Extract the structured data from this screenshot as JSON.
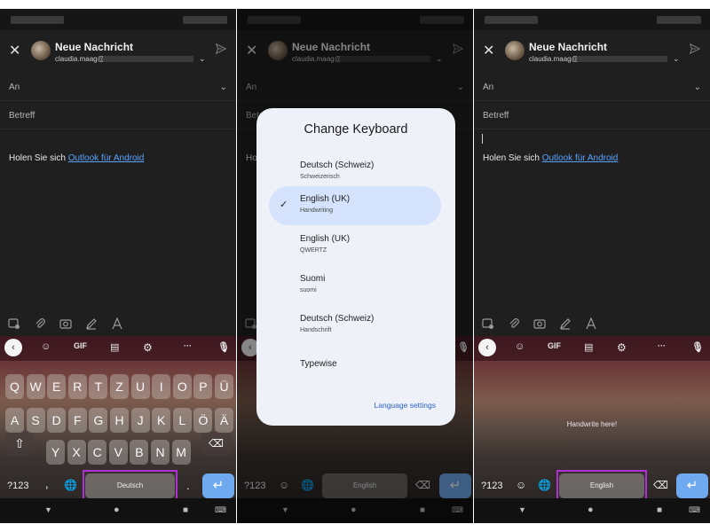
{
  "header": {
    "title": "Neue Nachricht",
    "email_prefix": "claudia.maag@"
  },
  "fields": {
    "to_label": "An",
    "subject_label": "Betreff"
  },
  "body": {
    "prefix": "Holen Sie sich ",
    "link": "Outlook für Android"
  },
  "keyboard": {
    "gif_label": "GIF",
    "row1": [
      "Q",
      "W",
      "E",
      "R",
      "T",
      "Z",
      "U",
      "I",
      "O",
      "P",
      "Ü"
    ],
    "row2": [
      "A",
      "S",
      "D",
      "F",
      "G",
      "H",
      "J",
      "K",
      "L",
      "Ö",
      "Ä"
    ],
    "row3": [
      "Y",
      "X",
      "C",
      "V",
      "B",
      "N",
      "M"
    ],
    "numbers_label": "?123",
    "comma": ",",
    "period": ".",
    "space_deutsch": "Deutsch",
    "space_english": "English",
    "handwrite_hint": "Handwrite here!"
  },
  "dialog": {
    "title": "Change Keyboard",
    "options": [
      {
        "name": "Deutsch (Schweiz)",
        "sub": "Schweizerisch",
        "selected": false
      },
      {
        "name": "English (UK)",
        "sub": "Handwriting",
        "selected": true
      },
      {
        "name": "English (UK)",
        "sub": "QWERTZ",
        "selected": false
      },
      {
        "name": "Suomi",
        "sub": "suomi",
        "selected": false
      },
      {
        "name": "Deutsch (Schweiz)",
        "sub": "Handschrift",
        "selected": false
      },
      {
        "name": "Typewise",
        "sub": "",
        "selected": false
      }
    ],
    "language_settings": "Language settings"
  },
  "colors": {
    "link": "#5aa3ff",
    "highlight": "#b12fd6",
    "enter_key": "#6fa9ef",
    "dialog_selected": "#d4e3fb"
  }
}
